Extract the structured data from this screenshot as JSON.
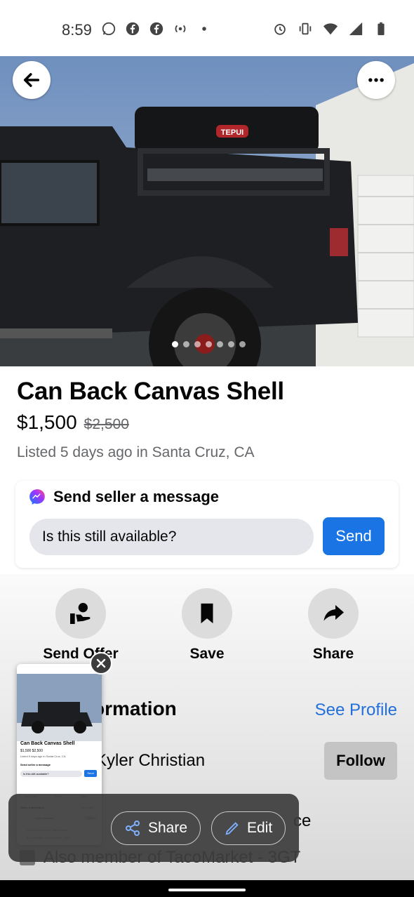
{
  "status_bar": {
    "time": "8:59",
    "left_icons": [
      "whatsapp-icon",
      "facebook-icon",
      "facebook-icon",
      "hotspot-icon",
      "dot-icon"
    ],
    "right_icons": [
      "alarm-icon",
      "vibrate-icon",
      "wifi-icon",
      "signal-icon",
      "battery-icon"
    ]
  },
  "hero": {
    "back_icon": "arrow-left-icon",
    "more_icon": "more-horizontal-icon",
    "image_count": 7,
    "active_index": 0,
    "rack_logo": "TEPUI"
  },
  "listing": {
    "title": "Can Back Canvas Shell",
    "price": "$1,500",
    "original_price": "$2,500",
    "listed": "Listed 5 days ago in Santa Cruz, CA"
  },
  "message": {
    "heading": "Send seller a message",
    "input_value": "Is this still available?",
    "send_label": "Send"
  },
  "actions": [
    {
      "label": "Send Offer",
      "icon": "offer-hand-icon"
    },
    {
      "label": "Save",
      "icon": "bookmark-icon"
    },
    {
      "label": "Share",
      "icon": "share-arrow-icon"
    }
  ],
  "seller": {
    "heading_visible": "ormation",
    "see_profile": "See Profile",
    "name_visible": "Kyler Christian",
    "follow_label": "Follow",
    "row1_visible": "ce",
    "row2_visible": "Also member of TacoMarket - 3GT"
  },
  "preview": {
    "title": "Can Back Canvas Shell",
    "price": "$1,500 $2,500",
    "listed": "Listed 5 days ago in Santa Cruz, CA",
    "msg_head": "Send seller a message",
    "input": "Is this still available?",
    "send": "Send",
    "actions": [
      "Send Offer",
      "Save",
      "Share"
    ],
    "seller_heading": "Seller Information",
    "see_profile": "See Profile",
    "seller_name": "Kyler Christian",
    "follow": "Follow",
    "row1": "Very Responsive on Marketplace",
    "row2": "Also member of TacoMarket - 3GT"
  },
  "toolbar": {
    "share_label": "Share",
    "edit_label": "Edit"
  },
  "colors": {
    "accent": "#1b74e4",
    "link": "#216fdb",
    "muted": "#65676b"
  }
}
